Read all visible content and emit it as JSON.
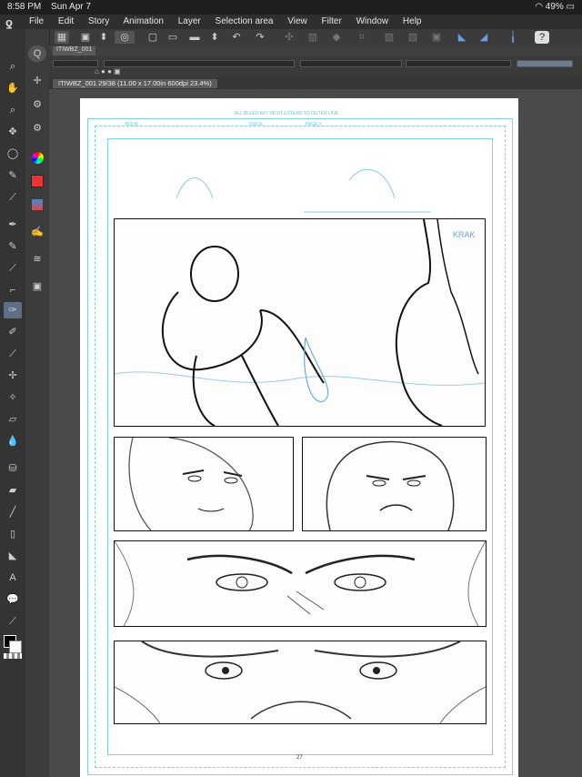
{
  "status": {
    "time": "8:58 PM",
    "date": "Sun Apr 7",
    "battery": "49%"
  },
  "menu": [
    "File",
    "Edit",
    "Story",
    "Animation",
    "Layer",
    "Selection area",
    "View",
    "Filter",
    "Window",
    "Help"
  ],
  "subtab": {
    "label": "ITIWBZ_001"
  },
  "document": {
    "tab_label": "ITIWBZ_001 29/38 (11.00 x 17.00in 600dpi 23.4%)"
  },
  "page": {
    "guide_top": "ALL BLEED ART MUST EXTEND TO OUTER LINE",
    "book_label": "BOOK",
    "issue_label": "ISSUE",
    "page_label": "PAGE #",
    "sfx_text": "KRAK",
    "page_number": "27"
  },
  "colors": {
    "accent": "#5f6f83",
    "guide": "#83d0e6",
    "ink": "#111111"
  }
}
